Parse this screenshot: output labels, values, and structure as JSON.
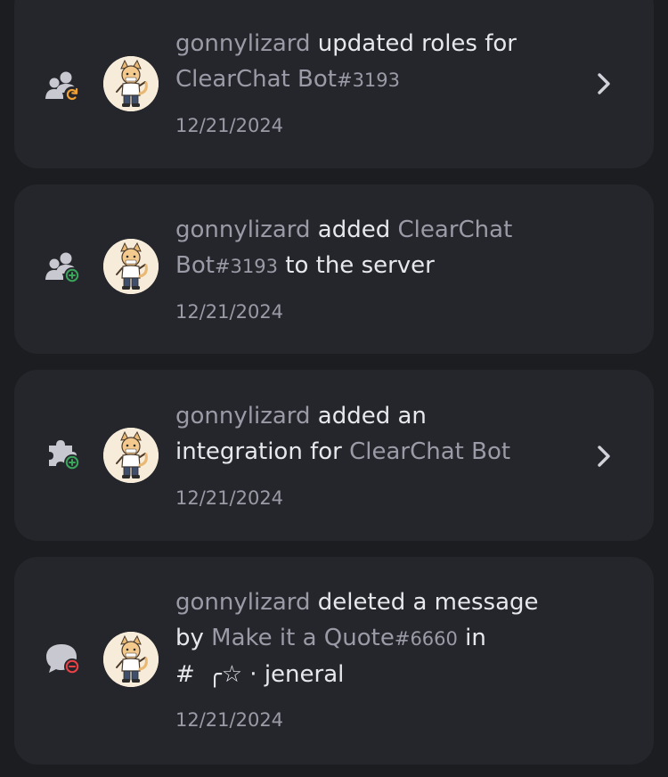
{
  "entries": [
    {
      "actor": "gonnylizard",
      "action_1": "updated roles for",
      "target": "ClearChat Bot",
      "target_tag": "#3193",
      "date": "12/21/2024",
      "icon": "user-roles-update-icon"
    },
    {
      "actor": "gonnylizard",
      "action_1": "added",
      "target_a": "ClearChat",
      "target_b": "Bot",
      "target_tag": "#3193",
      "action_2": "to the server",
      "date": "12/21/2024",
      "icon": "user-add-icon"
    },
    {
      "actor": "gonnylizard",
      "action_1": "added an",
      "action_2": "integration for",
      "target": "ClearChat Bot",
      "date": "12/21/2024",
      "icon": "integration-add-icon"
    },
    {
      "actor": "gonnylizard",
      "action_1": "deleted a message",
      "by": "by",
      "target": "Make it a Quote",
      "target_tag": "#6660",
      "in": "in",
      "channel_hash": "#",
      "channel_deco": "╭☆",
      "channel_sep": "·",
      "channel_name": "jeneral",
      "date": "12/21/2024",
      "icon": "message-delete-icon"
    }
  ],
  "colors": {
    "background": "#1c1d21",
    "card": "#25262c",
    "primary_text": "#e7e8ec",
    "muted_text": "#9a9ba6",
    "update_badge": "#f0a232",
    "add_badge": "#3ba55c",
    "delete_badge": "#ed4245"
  }
}
